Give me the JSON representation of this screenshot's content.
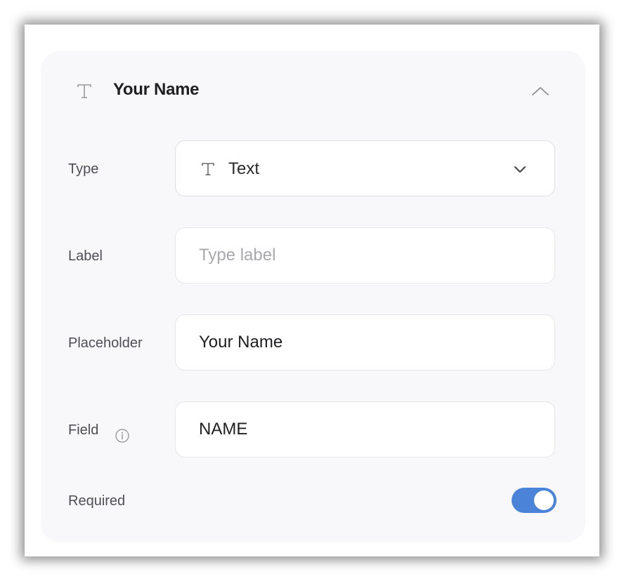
{
  "header": {
    "title": "Your Name",
    "icon": "text-type-icon",
    "collapse_icon": "chevron-up-icon"
  },
  "fields": {
    "type": {
      "label": "Type",
      "value": "Text",
      "icon": "text-type-icon",
      "dropdown_icon": "chevron-down-icon"
    },
    "label": {
      "label": "Label",
      "value": "",
      "placeholder": "Type label"
    },
    "placeholder": {
      "label": "Placeholder",
      "value": "Your Name"
    },
    "field": {
      "label": "Field",
      "value": "NAME",
      "info_icon": "info-icon"
    },
    "required": {
      "label": "Required",
      "enabled": true
    }
  },
  "colors": {
    "toggle_on": "#4a83d8",
    "card_background": "#f8f8fa"
  }
}
